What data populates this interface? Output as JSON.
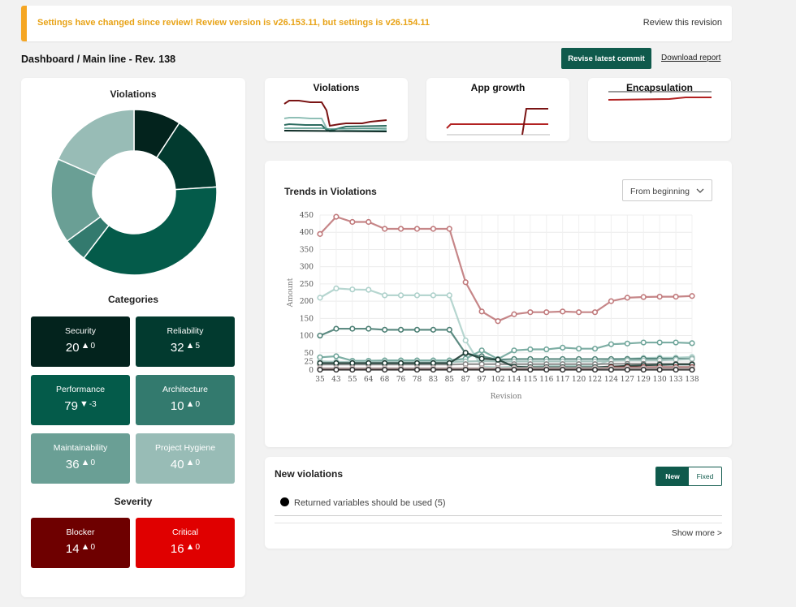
{
  "banner": {
    "message": "Settings have changed since review! Review version is v26.153.11, but settings is v26.154.11",
    "link": "Review this revision"
  },
  "header": {
    "title": "Dashboard / Main line - Rev. 138",
    "revise_button": "Revise latest commit",
    "download_link": "Download report"
  },
  "left": {
    "violations_title": "Violations",
    "categories_title": "Categories",
    "severity_title": "Severity"
  },
  "categories": [
    {
      "name": "Security",
      "value": "20",
      "arrow": "▲",
      "delta": "0",
      "color": "#03231d"
    },
    {
      "name": "Reliability",
      "value": "32",
      "arrow": "▲",
      "delta": "5",
      "color": "#023a2f"
    },
    {
      "name": "Performance",
      "value": "79",
      "arrow": "▼",
      "delta": "-3",
      "color": "#045b4a"
    },
    {
      "name": "Architecture",
      "value": "10",
      "arrow": "▲",
      "delta": "0",
      "color": "#337a6e"
    },
    {
      "name": "Maintainability",
      "value": "36",
      "arrow": "▲",
      "delta": "0",
      "color": "#6a9f95"
    },
    {
      "name": "Project Hygiene",
      "value": "40",
      "arrow": "▲",
      "delta": "0",
      "color": "#98bcb6"
    }
  ],
  "severity": [
    {
      "name": "Blocker",
      "value": "14",
      "arrow": "▲",
      "delta": "0",
      "color": "#6e0000"
    },
    {
      "name": "Critical",
      "value": "16",
      "arrow": "▲",
      "delta": "0",
      "color": "#e00000"
    }
  ],
  "minis": {
    "violations": "Violations",
    "app_growth": "App growth",
    "encapsulation": "Encapsulation"
  },
  "trends": {
    "title": "Trends in Violations",
    "range_select": "From beginning"
  },
  "chart_data": {
    "type": "line",
    "xlabel": "Revision",
    "ylabel": "Amount",
    "ylim": [
      0,
      450
    ],
    "yticks": [
      0,
      25,
      50,
      100,
      150,
      200,
      250,
      300,
      350,
      400,
      450
    ],
    "grid": true,
    "x": [
      "35",
      "43",
      "55",
      "64",
      "68",
      "76",
      "78",
      "83",
      "85",
      "87",
      "97",
      "102",
      "114",
      "115",
      "116",
      "117",
      "120",
      "122",
      "124",
      "127",
      "129",
      "130",
      "133",
      "138"
    ],
    "series": [
      {
        "color": "#c0797b",
        "values": [
          395,
          445,
          430,
          430,
          410,
          410,
          410,
          410,
          410,
          255,
          170,
          142,
          162,
          168,
          168,
          170,
          168,
          168,
          200,
          210,
          212,
          213,
          213,
          215
        ]
      },
      {
        "color": "#aed1cb",
        "values": [
          210,
          237,
          234,
          233,
          217,
          217,
          217,
          217,
          217,
          86,
          10,
          8,
          10,
          10,
          12,
          12,
          12,
          12,
          30,
          33,
          35,
          36,
          36,
          38
        ]
      },
      {
        "color": "#4d8075",
        "values": [
          100,
          120,
          120,
          120,
          117,
          117,
          117,
          117,
          117,
          48,
          40,
          30,
          32,
          32,
          32,
          32,
          32,
          32,
          32,
          32,
          33,
          33,
          33,
          33
        ]
      },
      {
        "color": "#6fa59a",
        "values": [
          37,
          40,
          27,
          27,
          28,
          28,
          28,
          28,
          28,
          33,
          57,
          32,
          57,
          60,
          60,
          65,
          62,
          62,
          75,
          77,
          80,
          80,
          80,
          78
        ]
      },
      {
        "color": "#a1c1bb",
        "values": [
          25,
          24,
          23,
          23,
          23,
          23,
          23,
          23,
          23,
          25,
          26,
          25,
          25,
          25,
          25,
          25,
          25,
          25,
          27,
          28,
          28,
          28,
          30,
          32
        ]
      },
      {
        "color": "#888888",
        "values": [
          16,
          16,
          16,
          16,
          16,
          16,
          16,
          16,
          16,
          17,
          17,
          17,
          17,
          17,
          17,
          17,
          17,
          17,
          18,
          18,
          18,
          18,
          18,
          18
        ]
      },
      {
        "color": "#1f3d35",
        "values": [
          20,
          20,
          20,
          20,
          20,
          20,
          20,
          20,
          20,
          50,
          33,
          30,
          10,
          8,
          8,
          8,
          8,
          8,
          10,
          12,
          14,
          15,
          16,
          16
        ]
      },
      {
        "color": "#7a1d1d",
        "values": [
          3,
          3,
          3,
          3,
          3,
          3,
          3,
          3,
          3,
          3,
          3,
          3,
          3,
          3,
          3,
          3,
          3,
          3,
          8,
          8,
          8,
          8,
          8,
          8
        ]
      },
      {
        "color": "#c2b2b2",
        "values": [
          6,
          6,
          6,
          6,
          6,
          6,
          6,
          6,
          6,
          6,
          6,
          6,
          6,
          6,
          6,
          6,
          6,
          6,
          6,
          6,
          6,
          6,
          6,
          6
        ]
      },
      {
        "color": "#333333",
        "values": [
          1,
          1,
          1,
          1,
          1,
          1,
          1,
          1,
          1,
          1,
          1,
          1,
          1,
          1,
          1,
          1,
          1,
          1,
          1,
          1,
          1,
          1,
          1,
          1
        ]
      }
    ]
  },
  "new_violations": {
    "title": "New violations",
    "toggle_new": "New",
    "toggle_fixed": "Fixed",
    "item": "Returned variables should be used (5)",
    "show_more": "Show more >"
  }
}
